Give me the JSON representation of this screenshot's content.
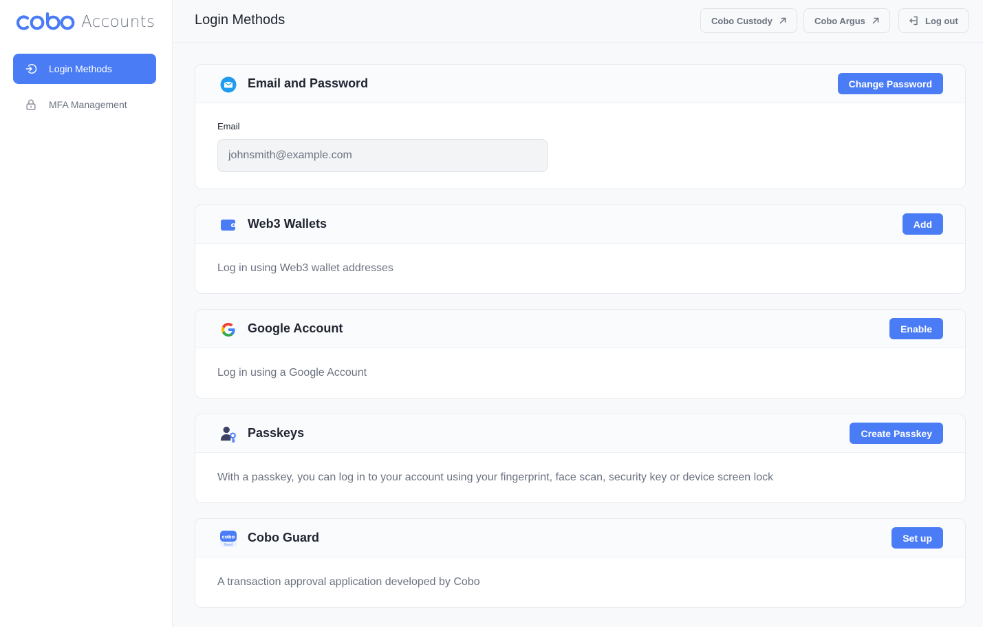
{
  "app": {
    "brand": "cobo",
    "section": "Accounts"
  },
  "sidebar": {
    "items": [
      {
        "label": "Login Methods",
        "icon": "login-icon",
        "active": true
      },
      {
        "label": "MFA Management",
        "icon": "lock-icon",
        "active": false
      }
    ]
  },
  "header": {
    "title": "Login Methods",
    "links": [
      {
        "label": "Cobo Custody",
        "icon": "external-arrow-icon"
      },
      {
        "label": "Cobo Argus",
        "icon": "external-arrow-icon"
      }
    ],
    "logout_label": "Log out"
  },
  "cards": {
    "email": {
      "title": "Email and Password",
      "action": "Change Password",
      "field_label": "Email",
      "field_value": "johnsmith@example.com"
    },
    "web3": {
      "title": "Web3 Wallets",
      "action": "Add",
      "description": "Log in using Web3 wallet addresses"
    },
    "google": {
      "title": "Google Account",
      "action": "Enable",
      "description": "Log in using a Google Account"
    },
    "passkeys": {
      "title": "Passkeys",
      "action": "Create Passkey",
      "description": "With a passkey, you can log in to your account using your fingerprint, face scan, security key or device screen lock"
    },
    "guard": {
      "title": "Cobo Guard",
      "action": "Set up",
      "description": "A transaction approval application developed by Cobo",
      "icon_text": "cobo",
      "icon_subtext": "Guard"
    }
  },
  "colors": {
    "accent": "#4a7cf6",
    "text": "#1f2430",
    "muted": "#6b7280",
    "background": "#f8f9fb"
  }
}
